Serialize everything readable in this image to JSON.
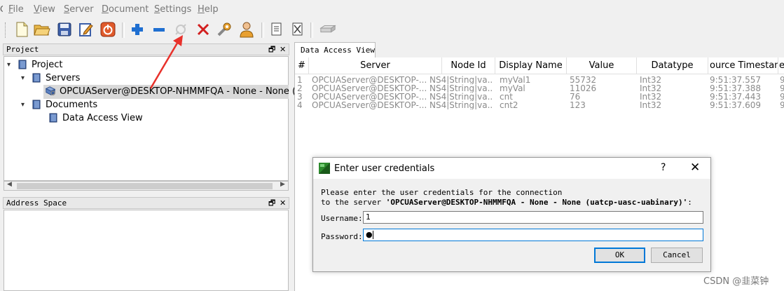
{
  "menu": {
    "items": [
      {
        "first": "F",
        "rest": "ile"
      },
      {
        "first": "V",
        "rest": "iew"
      },
      {
        "first": "S",
        "rest": "erver"
      },
      {
        "first": "D",
        "rest": "ocument"
      },
      {
        "first": "S",
        "rest": "ettings"
      },
      {
        "first": "H",
        "rest": "elp"
      }
    ]
  },
  "toolbar": {
    "buttons": [
      "new-document",
      "open-folder",
      "save",
      "edit",
      "power",
      "add",
      "remove",
      "connect",
      "disconnect",
      "properties",
      "user",
      "report",
      "delete-report",
      "server"
    ],
    "colors": {
      "add": "#1f6fd1",
      "remove": "#1f6fd1",
      "disconnect": "#d21f1f",
      "power": "#e05a2b"
    }
  },
  "project_panel": {
    "title": "Project",
    "ctrl_restore": "🗗",
    "ctrl_close": "✕",
    "tree": {
      "root": "Project",
      "servers": "Servers",
      "server_node": "OPCUAServer@DESKTOP-NHMMFQA - None - None (u",
      "documents": "Documents",
      "doc_node": "Data Access View"
    }
  },
  "address_panel": {
    "title": "Address Space",
    "ctrl_restore": "🗗",
    "ctrl_close": "✕"
  },
  "tabs": [
    "Data Access View"
  ],
  "grid": {
    "columns": [
      "#",
      "Server",
      "Node Id",
      "Display Name",
      "Value",
      "Datatype",
      "ource Timestam",
      "e"
    ],
    "rows": [
      [
        "1",
        "OPCUAServer@DESKTOP-...",
        "NS4|String|va...",
        "myVal1",
        "55732",
        "Int32",
        "9:51:37.557",
        "9"
      ],
      [
        "2",
        "OPCUAServer@DESKTOP-...",
        "NS4|String|va...",
        "myVal",
        "11026",
        "Int32",
        "9:51:37.388",
        "9"
      ],
      [
        "3",
        "OPCUAServer@DESKTOP-...",
        "NS4|String|va...",
        "cnt",
        "76",
        "Int32",
        "9:51:37.443",
        "9"
      ],
      [
        "4",
        "OPCUAServer@DESKTOP-...",
        "NS4|String|va...",
        "cnt2",
        "123",
        "Int32",
        "9:51:37.609",
        "9"
      ]
    ]
  },
  "dialog": {
    "title": "Enter user credentials",
    "help": "?",
    "close": "✕",
    "message_line1": "Please enter the user credentials for the connection",
    "message_line2_prefix": "to the server ",
    "message_server": "'OPCUAServer@DESKTOP-NHMMFQA - None - None (uatcp-uasc-uabinary)'",
    "message_line2_suffix": ":",
    "username_label": "Username:",
    "username_value": "1",
    "password_label": "Password:",
    "password_value": "●",
    "ok_label": "OK",
    "cancel_label": "Cancel"
  },
  "watermark": "CSDN @韭菜钟",
  "colors": {
    "annotation_arrow": "#e8312b",
    "selection": "#d9d9d9",
    "accent": "#0078d7"
  }
}
